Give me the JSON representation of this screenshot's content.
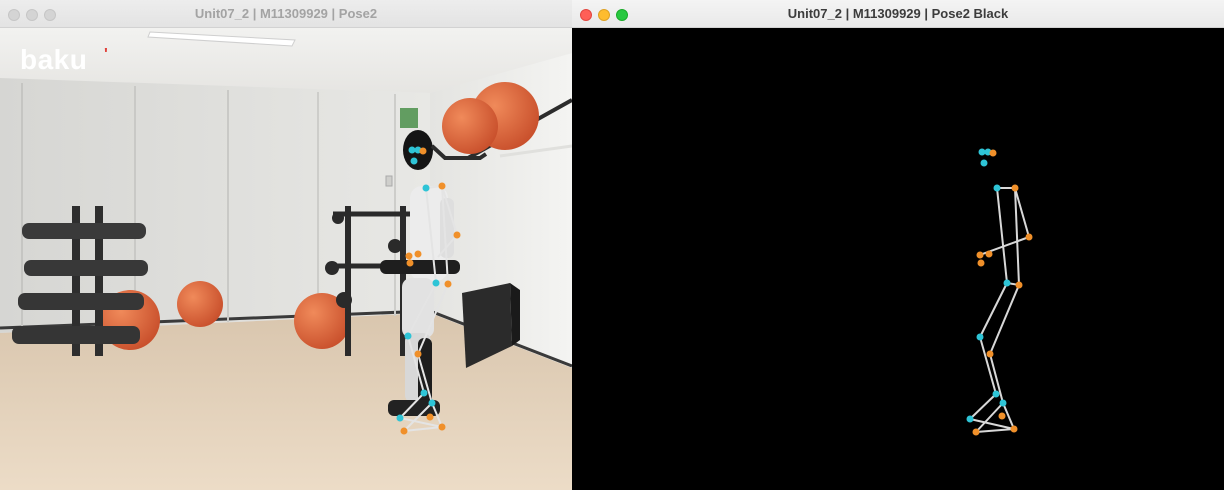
{
  "left_window": {
    "title": "Unit07_2 | M11309929 | Pose2",
    "active": false,
    "logo_text": "baku",
    "logo_mark": "'"
  },
  "right_window": {
    "title": "Unit07_2 | M11309929 | Pose2 Black",
    "active": true,
    "background": "#000000"
  },
  "colors": {
    "keypoint_left": "#2ec4d6",
    "keypoint_right": "#f0902a",
    "bone": "#d8d8d8"
  },
  "icons": [
    "close-icon",
    "minimize-icon",
    "zoom-icon"
  ]
}
